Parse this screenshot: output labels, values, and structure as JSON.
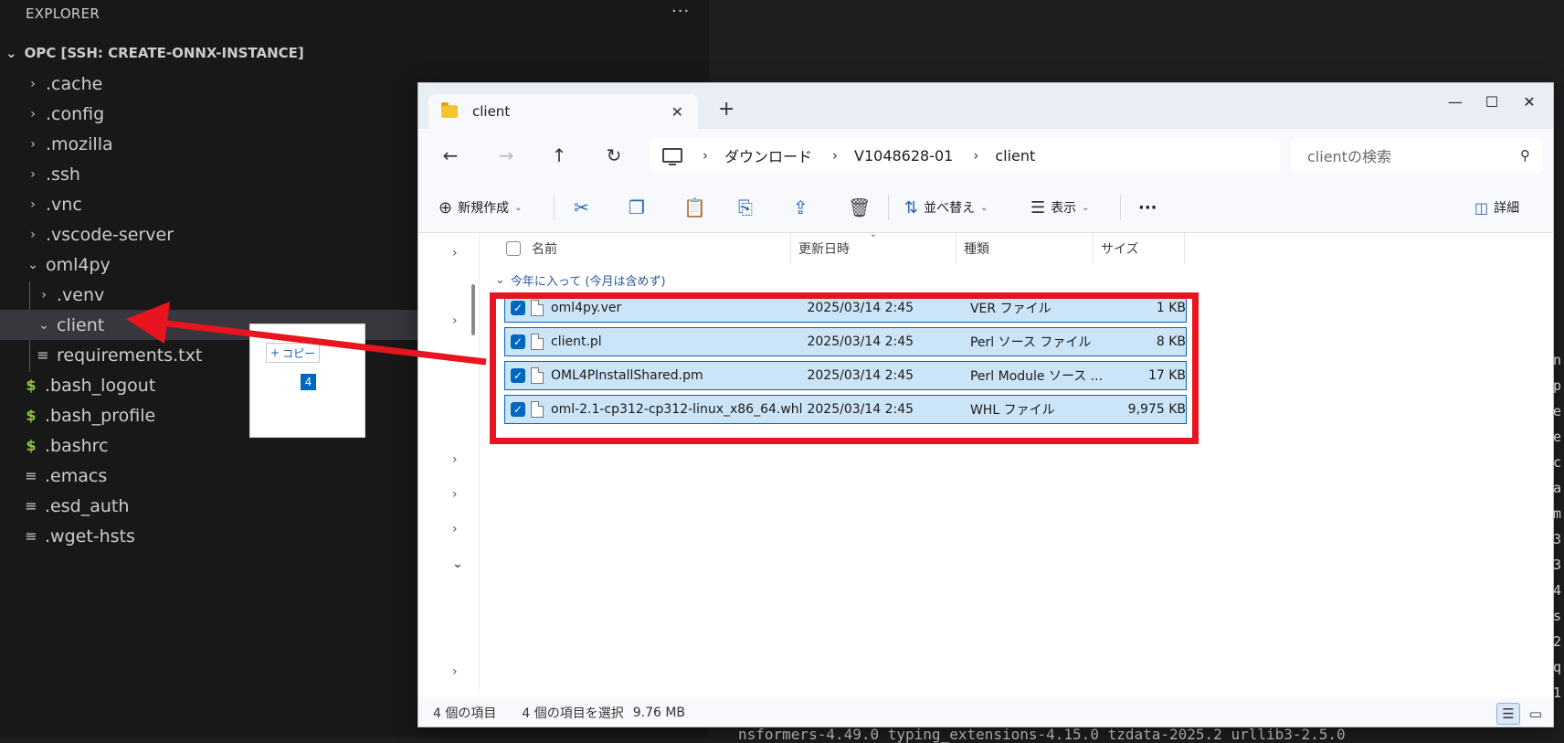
{
  "explorer": {
    "header": "EXPLORER",
    "more": "···",
    "root_label": "OPC [SSH: CREATE-ONNX-INSTANCE]",
    "items": [
      {
        "label": ".cache",
        "chevron": "›"
      },
      {
        "label": ".config",
        "chevron": "›"
      },
      {
        "label": ".mozilla",
        "chevron": "›"
      },
      {
        "label": ".ssh",
        "chevron": "›"
      },
      {
        "label": ".vnc",
        "chevron": "›"
      },
      {
        "label": ".vscode-server",
        "chevron": "›"
      },
      {
        "label": "oml4py",
        "chevron": "⌄"
      },
      {
        "label": ".venv",
        "chevron": "›"
      },
      {
        "label": "client",
        "chevron": "⌄"
      },
      {
        "label": "requirements.txt",
        "icon": "≡"
      },
      {
        "label": ".bash_logout",
        "icon": "$"
      },
      {
        "label": ".bash_profile",
        "icon": "$"
      },
      {
        "label": ".bashrc",
        "icon": "$"
      },
      {
        "label": ".emacs",
        "icon": "≡"
      },
      {
        "label": ".esd_auth",
        "icon": "≡"
      },
      {
        "label": ".wget-hsts",
        "icon": "≡"
      }
    ]
  },
  "drag_preview": {
    "copy_label": "コピー",
    "count": "4"
  },
  "terminal": {
    "bottom_line": "nsformers-4.49.0 typing_extensions-4.15.0 tzdata-2025.2 urllib3-2.5.0",
    "edge_chars": "n p e e c a   m 3 3 4 s 2 q 1"
  },
  "window": {
    "tab_label": "client",
    "new_tab": "+",
    "controls": {
      "minimize": "—",
      "maximize": "☐",
      "close": "✕"
    },
    "nav": {
      "back": "←",
      "forward": "→",
      "up": "↑",
      "refresh": "↻"
    },
    "breadcrumb": [
      "ダウンロード",
      "V1048628-01",
      "client"
    ],
    "breadcrumb_sep": "›",
    "search_placeholder": "clientの検索",
    "commands": {
      "new": "新規作成",
      "sort": "並べ替え",
      "view": "表示",
      "more": "···",
      "details": "詳細"
    },
    "columns": [
      "名前",
      "更新日時",
      "種類",
      "サイズ"
    ],
    "group_label": "今年に入って (今月は含めず)",
    "files": [
      {
        "name": "oml4py.ver",
        "date": "2025/03/14 2:45",
        "type": "VER ファイル",
        "size": "1 KB"
      },
      {
        "name": "client.pl",
        "date": "2025/03/14 2:45",
        "type": "Perl ソース ファイル",
        "size": "8 KB"
      },
      {
        "name": "OML4PInstallShared.pm",
        "date": "2025/03/14 2:45",
        "type": "Perl Module ソース ...",
        "size": "17 KB"
      },
      {
        "name": "oml-2.1-cp312-cp312-linux_x86_64.whl",
        "date": "2025/03/14 2:45",
        "type": "WHL ファイル",
        "size": "9,975 KB"
      }
    ],
    "status": {
      "count": "4 個の項目",
      "selected": "4 個の項目を選択",
      "size": "9.76 MB"
    }
  },
  "colors": {
    "highlight": "#e8141f",
    "selection": "#cce4f7",
    "accent": "#0067c0"
  }
}
